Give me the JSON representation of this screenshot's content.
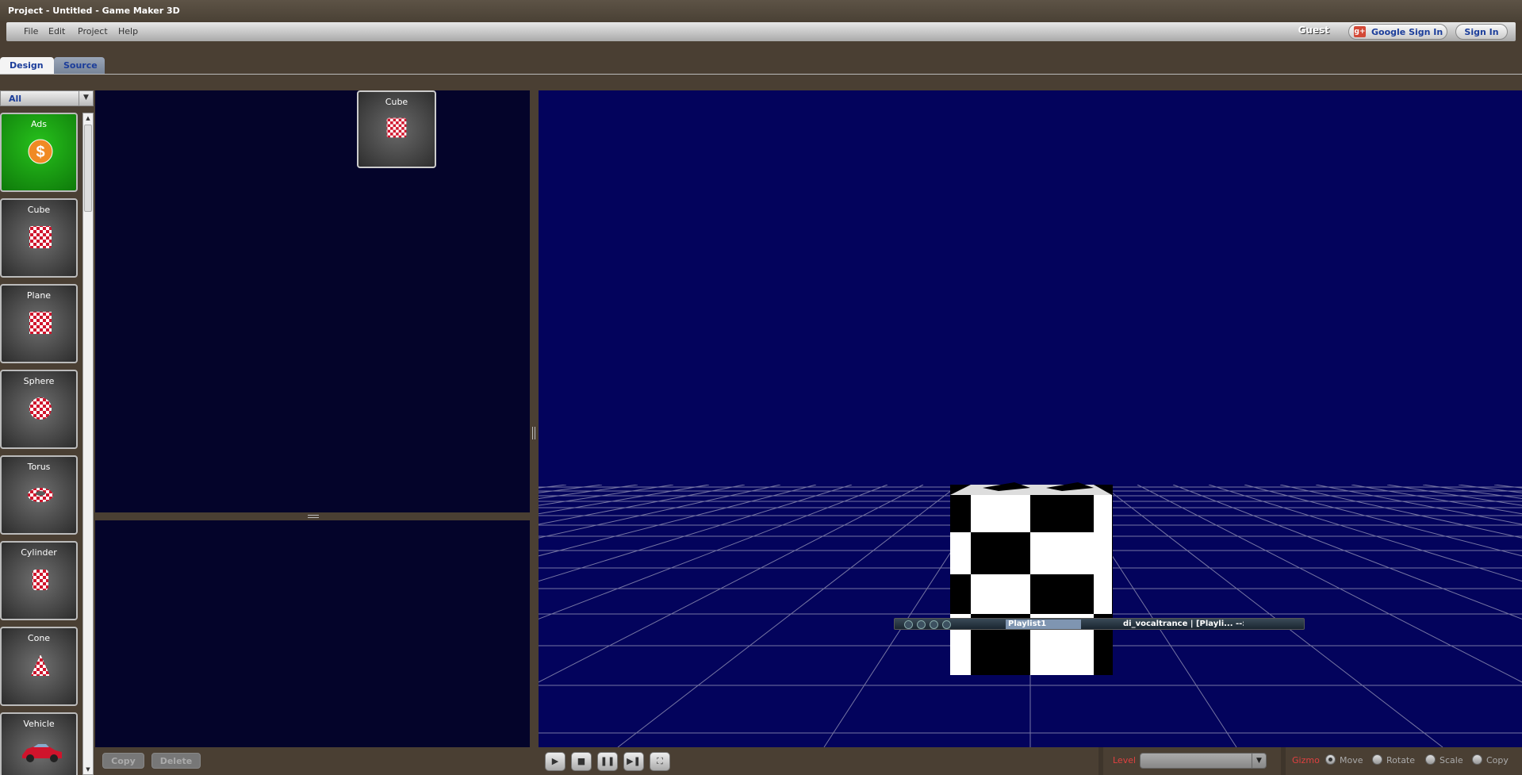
{
  "window": {
    "title": "Project - Untitled - Game Maker 3D"
  },
  "menu": {
    "items": [
      "File",
      "Edit",
      "Project",
      "Help"
    ]
  },
  "auth": {
    "guest_label": "Guest",
    "google_signin": "Google Sign In",
    "signin": "Sign In",
    "google_icon_glyph": "g+"
  },
  "tabs": [
    {
      "label": "Design",
      "active": true
    },
    {
      "label": "Source",
      "active": false
    }
  ],
  "palette": {
    "filter_value": "All",
    "items": [
      {
        "label": "Ads",
        "icon": "dollar-coin-icon"
      },
      {
        "label": "Cube",
        "icon": "checkered-cube-icon"
      },
      {
        "label": "Plane",
        "icon": "checkered-plane-icon"
      },
      {
        "label": "Sphere",
        "icon": "checkered-sphere-icon"
      },
      {
        "label": "Torus",
        "icon": "checkered-torus-icon"
      },
      {
        "label": "Cylinder",
        "icon": "checkered-cylinder-icon"
      },
      {
        "label": "Cone",
        "icon": "checkered-cone-icon"
      },
      {
        "label": "Vehicle",
        "icon": "red-car-icon"
      }
    ]
  },
  "scene": {
    "objects": [
      {
        "label": "Cube",
        "icon": "checkered-cube-icon"
      }
    ]
  },
  "actions": {
    "copy": "Copy",
    "delete": "Delete"
  },
  "media_player": {
    "playlist": "Playlist1",
    "track": "di_vocaltrance | [Playli...  --:--"
  },
  "playback": {
    "icons": [
      "play-icon",
      "stop-icon",
      "pause-icon",
      "step-icon",
      "fullscreen-icon"
    ]
  },
  "level": {
    "label": "Level",
    "value": ""
  },
  "gizmo": {
    "label": "Gizmo",
    "options": [
      "Move",
      "Rotate",
      "Scale",
      "Copy"
    ],
    "selected": "Move"
  },
  "colors": {
    "accent_red": "#e04040",
    "link_blue": "#1b3d9a",
    "viewport_bg": "#03035c",
    "ads_green": "#1aa012"
  }
}
